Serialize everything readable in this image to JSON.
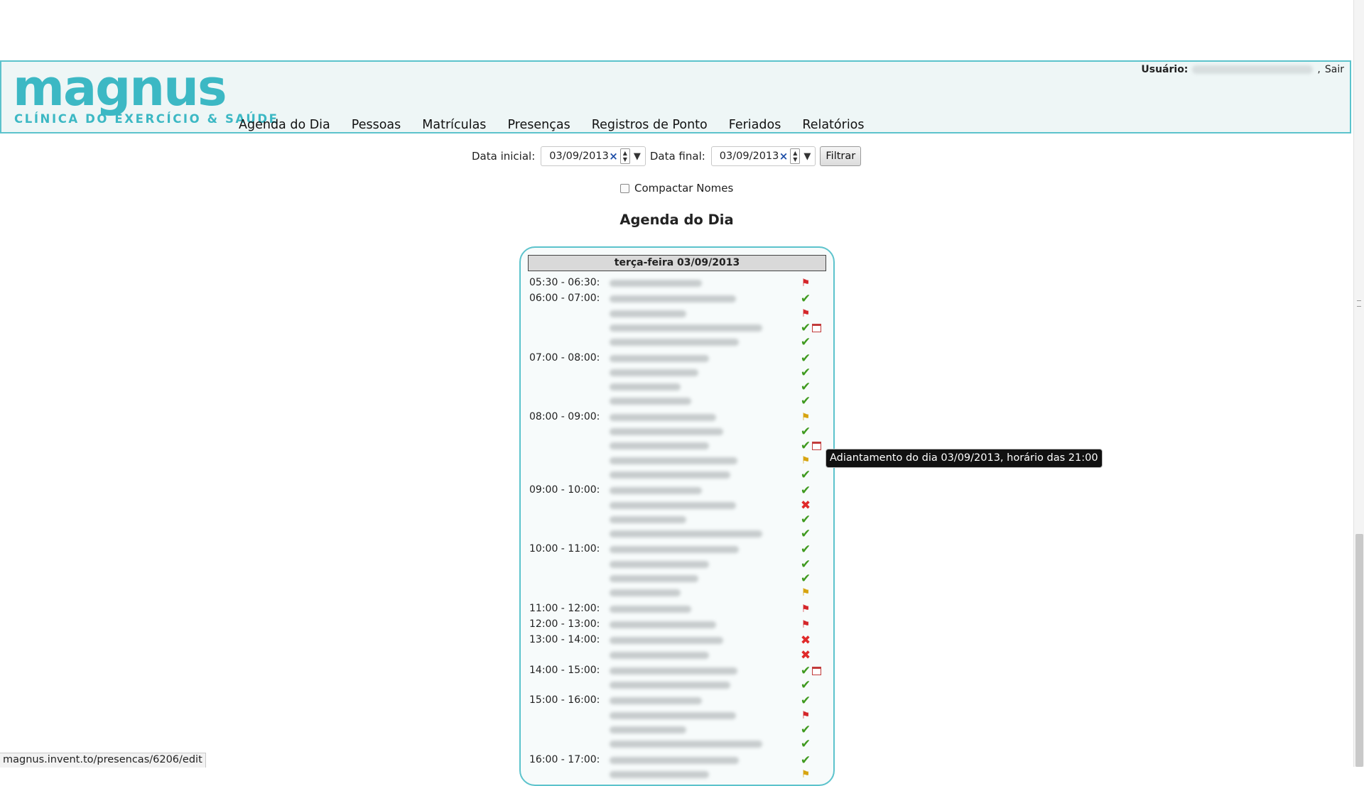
{
  "header": {
    "logo": {
      "word": "magnus",
      "tagline": "CLÍNICA DO EXERCÍCIO & SAÚDE"
    },
    "user_label": "Usuário:",
    "logout_label": "Sair",
    "nav": [
      "Agenda do Dia",
      "Pessoas",
      "Matrículas",
      "Presenças",
      "Registros de Ponto",
      "Feriados",
      "Relatórios"
    ]
  },
  "filters": {
    "start_label": "Data inicial:",
    "start_value": "03/09/2013",
    "end_label": "Data final:",
    "end_value": "03/09/2013",
    "clear_symbol": "×",
    "spin_up": "▲",
    "spin_down": "▼",
    "dropdown_symbol": "▼",
    "filter_button": "Filtrar",
    "compact_label": "Compactar Nomes",
    "compact_checked": false
  },
  "page_title": "Agenda do Dia",
  "schedule": {
    "day_label": "terça-feira 03/09/2013",
    "slots": [
      {
        "time": "05:30 - 06:30:",
        "entries": [
          {
            "status": "flag-red"
          }
        ]
      },
      {
        "time": "06:00 - 07:00:",
        "entries": [
          {
            "status": "check"
          },
          {
            "status": "flag-red"
          },
          {
            "status": "check",
            "calendar": true
          },
          {
            "status": "check"
          }
        ]
      },
      {
        "time": "07:00 - 08:00:",
        "entries": [
          {
            "status": "check"
          },
          {
            "status": "check"
          },
          {
            "status": "check"
          },
          {
            "status": "check"
          }
        ]
      },
      {
        "time": "08:00 - 09:00:",
        "entries": [
          {
            "status": "flag-yellow"
          },
          {
            "status": "check"
          },
          {
            "status": "check",
            "calendar": true
          },
          {
            "status": "flag-yellow"
          },
          {
            "status": "check"
          }
        ]
      },
      {
        "time": "09:00 - 10:00:",
        "entries": [
          {
            "status": "check"
          },
          {
            "status": "cross"
          },
          {
            "status": "check"
          },
          {
            "status": "check"
          }
        ]
      },
      {
        "time": "10:00 - 11:00:",
        "entries": [
          {
            "status": "check"
          },
          {
            "status": "check"
          },
          {
            "status": "check"
          },
          {
            "status": "flag-yellow"
          }
        ]
      },
      {
        "time": "11:00 - 12:00:",
        "entries": [
          {
            "status": "flag-red"
          }
        ]
      },
      {
        "time": "12:00 - 13:00:",
        "entries": [
          {
            "status": "flag-red"
          }
        ]
      },
      {
        "time": "13:00 - 14:00:",
        "entries": [
          {
            "status": "cross"
          },
          {
            "status": "cross"
          }
        ]
      },
      {
        "time": "14:00 - 15:00:",
        "entries": [
          {
            "status": "check",
            "calendar": true
          },
          {
            "status": "check"
          }
        ]
      },
      {
        "time": "15:00 - 16:00:",
        "entries": [
          {
            "status": "check"
          },
          {
            "status": "flag-red"
          },
          {
            "status": "check"
          },
          {
            "status": "check"
          }
        ]
      },
      {
        "time": "16:00 - 17:00:",
        "entries": [
          {
            "status": "check"
          },
          {
            "status": "flag-yellow"
          }
        ]
      }
    ]
  },
  "tooltip": "Adiantamento do dia 03/09/2013, horário das 21:00",
  "status_bar": "magnus.invent.to/presencas/6206/edit",
  "icons": {
    "check": "✔",
    "cross": "✖",
    "flag-red": "⚑",
    "flag-yellow": "⚑"
  },
  "colors": {
    "accent": "#3cb8c4",
    "header_bg": "#eef6f6",
    "check": "#3f9a1f",
    "cross": "#e02a2a",
    "flag_red": "#d4262a",
    "flag_yellow": "#d7a410"
  }
}
